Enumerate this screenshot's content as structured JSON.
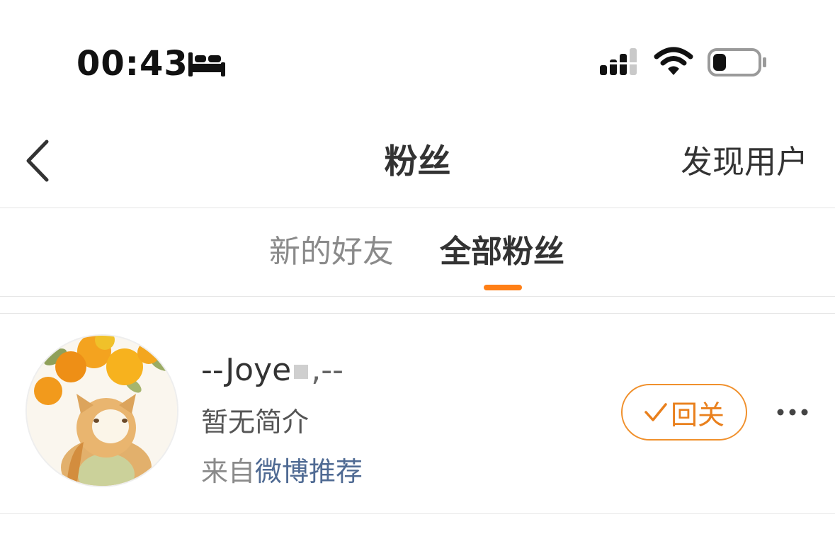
{
  "status_bar": {
    "time": "00:43",
    "icons": [
      "bed-icon",
      "signal-icon",
      "wifi-icon",
      "battery-icon"
    ]
  },
  "nav": {
    "back_icon": "chevron-left-icon",
    "title": "粉丝",
    "discover_label": "发现用户"
  },
  "tabs": [
    {
      "label": "新的好友",
      "active": false
    },
    {
      "label": "全部粉丝",
      "active": true
    }
  ],
  "colors": {
    "accent": "#ff7f16",
    "button_border": "#f0902c",
    "link": "#4f6a93"
  },
  "fans": [
    {
      "name_prefix": "--Joye",
      "name_suffix": ",--",
      "bio": "暂无简介",
      "source_prefix": "来自",
      "source_link": "微博推荐",
      "follow_back_label": "回关",
      "follow_back_icon": "check-icon",
      "more_icon": "more-dots-icon",
      "avatar": "avatar-cat-oranges"
    }
  ]
}
